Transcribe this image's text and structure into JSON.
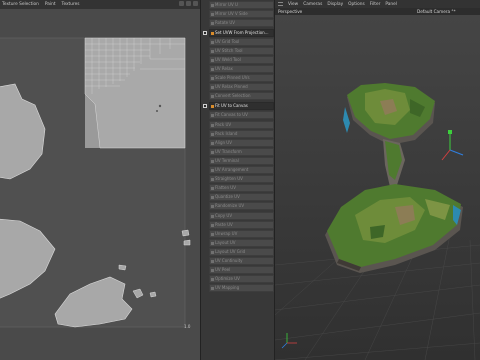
{
  "uv_editor": {
    "menu": [
      "Texture Selection",
      "Paint",
      "Textures"
    ],
    "coordinate_label": "1.0"
  },
  "commands": {
    "groups": [
      {
        "items": [
          {
            "label": "Mirror UV U",
            "state": "normal"
          },
          {
            "label": "Mirror UV V Side",
            "state": "normal"
          },
          {
            "label": "Rotate UV",
            "state": "normal"
          }
        ]
      },
      {
        "items": [
          {
            "label": "Set UVW From Projection...",
            "state": "active"
          },
          {
            "label": "UV Grid Tool",
            "state": "normal"
          },
          {
            "label": "UV Stitch Tool",
            "state": "normal"
          },
          {
            "label": "UV Weld Tool",
            "state": "normal"
          },
          {
            "label": "UV Relax",
            "state": "normal"
          },
          {
            "label": "Scale Pinned UVs",
            "state": "normal"
          },
          {
            "label": "UV Relax Pinned",
            "state": "normal"
          },
          {
            "label": "Convert Selection",
            "state": "normal"
          }
        ]
      },
      {
        "items": [
          {
            "label": "Fit UV to Canvas",
            "state": "active"
          },
          {
            "label": "Fit Canvas to UV",
            "state": "normal"
          }
        ]
      },
      {
        "items": [
          {
            "label": "Pack UV",
            "state": "normal"
          },
          {
            "label": "Pack Island",
            "state": "normal"
          },
          {
            "label": "Align UV",
            "state": "normal"
          },
          {
            "label": "UV Transform",
            "state": "normal"
          },
          {
            "label": "UV Terminal",
            "state": "normal"
          },
          {
            "label": "UV Arrangement",
            "state": "normal"
          },
          {
            "label": "Straighten UV",
            "state": "normal"
          },
          {
            "label": "Flatten UV",
            "state": "normal"
          },
          {
            "label": "Quantize UV",
            "state": "normal"
          },
          {
            "label": "Randomize UV",
            "state": "normal"
          }
        ]
      },
      {
        "items": [
          {
            "label": "Copy UV",
            "state": "normal"
          },
          {
            "label": "Paste UV",
            "state": "normal"
          },
          {
            "label": "Unwrap UV",
            "state": "normal"
          },
          {
            "label": "Layout UV",
            "state": "normal"
          },
          {
            "label": "Layout UV Grid",
            "state": "normal"
          },
          {
            "label": "UV Continuity",
            "state": "normal"
          },
          {
            "label": "UV Peel",
            "state": "normal"
          },
          {
            "label": "Optimize UV",
            "state": "normal"
          },
          {
            "label": "UV Mapping",
            "state": "normal"
          }
        ]
      }
    ]
  },
  "viewport": {
    "menu": [
      "View",
      "Cameras",
      "Display",
      "Options",
      "Filter",
      "Panel"
    ],
    "label": "Perspective",
    "camera": "Default Camera °*"
  },
  "colors": {
    "uv_background": "#4a4a4a",
    "uv_island_fill": "#a8a8a8",
    "commands_bg": "#383838",
    "viewport_bg": "#3a3a3a",
    "terrain_green": "#4f7a2f",
    "accent_orange": "#d98c2b"
  }
}
